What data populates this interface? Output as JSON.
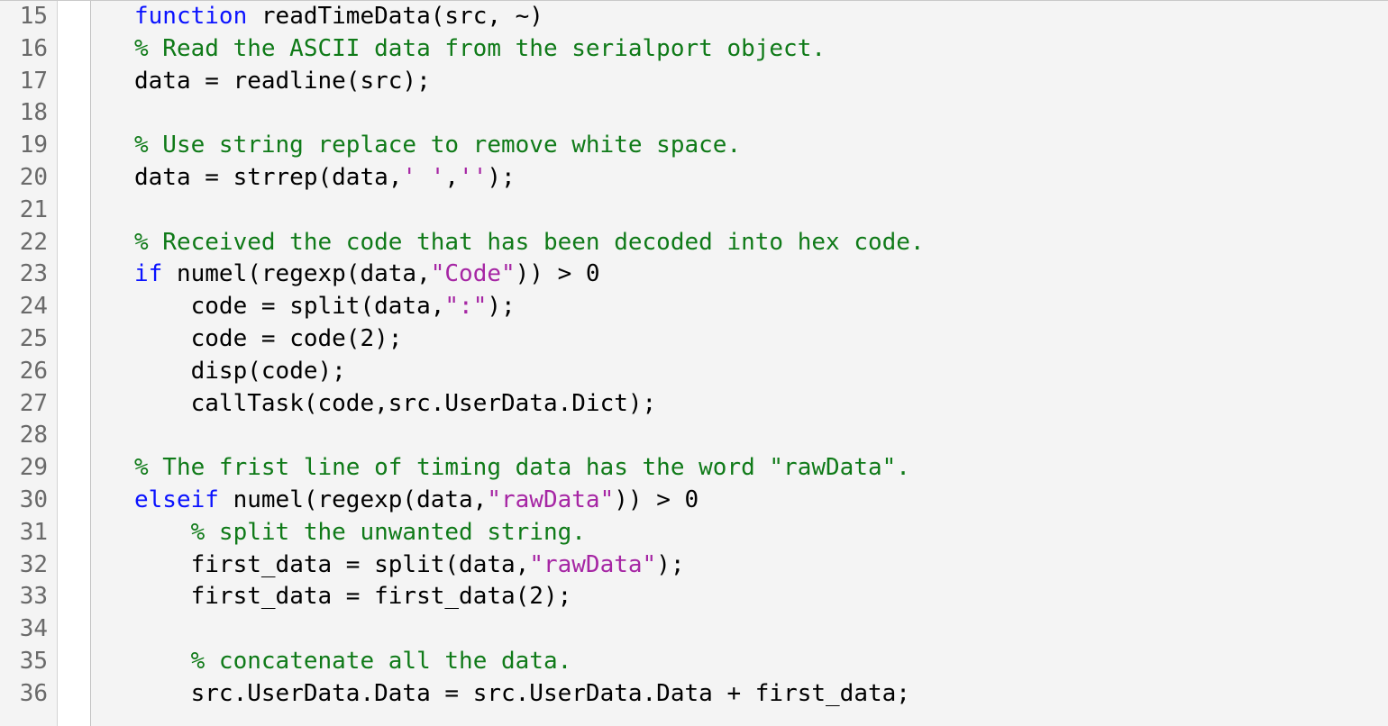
{
  "startLine": 15,
  "lines": [
    {
      "n": 15,
      "indent": 0,
      "t": [
        {
          "cls": "kw",
          "s": "function"
        },
        {
          "cls": "pln",
          "s": " readTimeData(src, ~)"
        }
      ]
    },
    {
      "n": 16,
      "indent": 0,
      "t": [
        {
          "cls": "cm",
          "s": "% Read the ASCII data from the serialport object."
        }
      ]
    },
    {
      "n": 17,
      "indent": 0,
      "t": [
        {
          "cls": "pln",
          "s": "data = readline(src);"
        }
      ]
    },
    {
      "n": 18,
      "indent": 0,
      "t": []
    },
    {
      "n": 19,
      "indent": 0,
      "t": [
        {
          "cls": "cm",
          "s": "% Use string replace to remove white space."
        }
      ]
    },
    {
      "n": 20,
      "indent": 0,
      "t": [
        {
          "cls": "pln",
          "s": "data = strrep(data,"
        },
        {
          "cls": "str",
          "s": "' '"
        },
        {
          "cls": "pln",
          "s": ","
        },
        {
          "cls": "str",
          "s": "''"
        },
        {
          "cls": "pln",
          "s": ");"
        }
      ]
    },
    {
      "n": 21,
      "indent": 0,
      "t": []
    },
    {
      "n": 22,
      "indent": 0,
      "t": [
        {
          "cls": "cm",
          "s": "% Received the code that has been decoded into hex code."
        }
      ]
    },
    {
      "n": 23,
      "indent": 0,
      "t": [
        {
          "cls": "kw",
          "s": "if"
        },
        {
          "cls": "pln",
          "s": " numel(regexp(data,"
        },
        {
          "cls": "str",
          "s": "\"Code\""
        },
        {
          "cls": "pln",
          "s": ")) > 0"
        }
      ]
    },
    {
      "n": 24,
      "indent": 1,
      "t": [
        {
          "cls": "pln",
          "s": "code = split(data,"
        },
        {
          "cls": "str",
          "s": "\":\""
        },
        {
          "cls": "pln",
          "s": ");"
        }
      ]
    },
    {
      "n": 25,
      "indent": 1,
      "t": [
        {
          "cls": "pln",
          "s": "code = code(2);"
        }
      ]
    },
    {
      "n": 26,
      "indent": 1,
      "t": [
        {
          "cls": "pln",
          "s": "disp(code);"
        }
      ]
    },
    {
      "n": 27,
      "indent": 1,
      "t": [
        {
          "cls": "pln",
          "s": "callTask(code,src.UserData.Dict);"
        }
      ]
    },
    {
      "n": 28,
      "indent": 0,
      "t": []
    },
    {
      "n": 29,
      "indent": 0,
      "t": [
        {
          "cls": "cm",
          "s": "% The frist line of timing data has the word \"rawData\"."
        }
      ]
    },
    {
      "n": 30,
      "indent": 0,
      "t": [
        {
          "cls": "kw",
          "s": "elseif"
        },
        {
          "cls": "pln",
          "s": " numel(regexp(data,"
        },
        {
          "cls": "str",
          "s": "\"rawData\""
        },
        {
          "cls": "pln",
          "s": ")) > 0"
        }
      ]
    },
    {
      "n": 31,
      "indent": 1,
      "t": [
        {
          "cls": "cm",
          "s": "% split the unwanted string."
        }
      ]
    },
    {
      "n": 32,
      "indent": 1,
      "t": [
        {
          "cls": "pln",
          "s": "first_data = split(data,"
        },
        {
          "cls": "str",
          "s": "\"rawData\""
        },
        {
          "cls": "pln",
          "s": ");"
        }
      ]
    },
    {
      "n": 33,
      "indent": 1,
      "t": [
        {
          "cls": "pln",
          "s": "first_data = first_data(2);"
        }
      ]
    },
    {
      "n": 34,
      "indent": 0,
      "t": []
    },
    {
      "n": 35,
      "indent": 1,
      "t": [
        {
          "cls": "cm",
          "s": "% concatenate all the data."
        }
      ]
    },
    {
      "n": 36,
      "indent": 1,
      "t": [
        {
          "cls": "pln",
          "s": "src.UserData.Data = src.UserData.Data + first_data;"
        }
      ]
    }
  ]
}
